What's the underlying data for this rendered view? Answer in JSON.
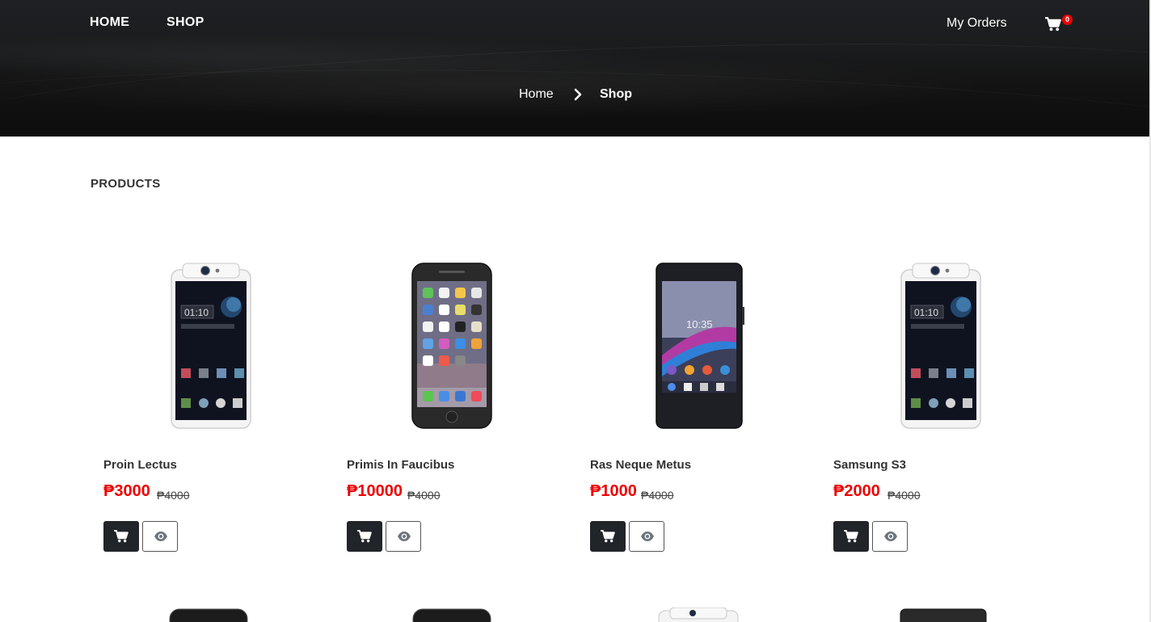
{
  "nav": {
    "home": "HOME",
    "shop": "SHOP",
    "my_orders": "My Orders",
    "cart_count": "0"
  },
  "breadcrumb": {
    "home": "Home",
    "current": "Shop"
  },
  "section_title": "PRODUCTS",
  "currency": "₱",
  "products": [
    {
      "name": "Proin Lectus",
      "price": "₱3000",
      "old_price": "₱4000",
      "image": "oppo-rotating-camera-phone-white"
    },
    {
      "name": "Primis In Faucibus",
      "price": "₱10000",
      "old_price": "₱4000",
      "image": "iphone-black"
    },
    {
      "name": "Ras Neque Metus",
      "price": "₱1000",
      "old_price": "₱4000",
      "image": "xperia-black"
    },
    {
      "name": "Samsung S3",
      "price": "₱2000",
      "old_price": "₱4000",
      "image": "oppo-rotating-camera-phone-white"
    }
  ],
  "icons": {
    "cart": "shopping-cart-icon",
    "view": "eye-icon",
    "breadcrumb_separator": "chevron-right-icon"
  },
  "colors": {
    "header_bg": "#1b1c1e",
    "price": "#ee0000",
    "badge": "#ee0000",
    "cart_button": "#212529"
  }
}
